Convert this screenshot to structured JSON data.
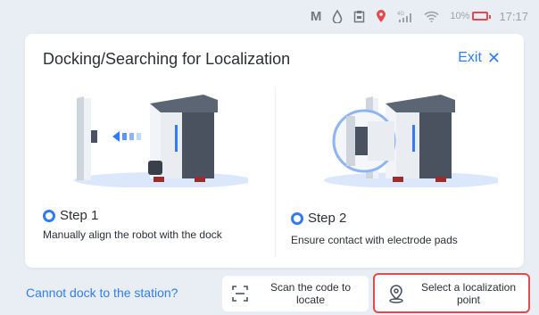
{
  "status_bar": {
    "m_label": "M",
    "signal_label": "4G",
    "battery_percent": "10%",
    "time": "17:17"
  },
  "dialog": {
    "title": "Docking/Searching for Localization",
    "exit_label": "Exit",
    "steps": [
      {
        "label": "Step 1",
        "description": "Manually align the robot with the dock"
      },
      {
        "label": "Step 2",
        "description": "Ensure contact with electrode pads"
      }
    ]
  },
  "footer": {
    "cannot_dock_link": "Cannot dock  to the station?",
    "scan_button": "Scan the code to locate",
    "select_button": "Select a localization point"
  },
  "colors": {
    "accent": "#2f7cf6",
    "highlight": "#e5484d"
  }
}
